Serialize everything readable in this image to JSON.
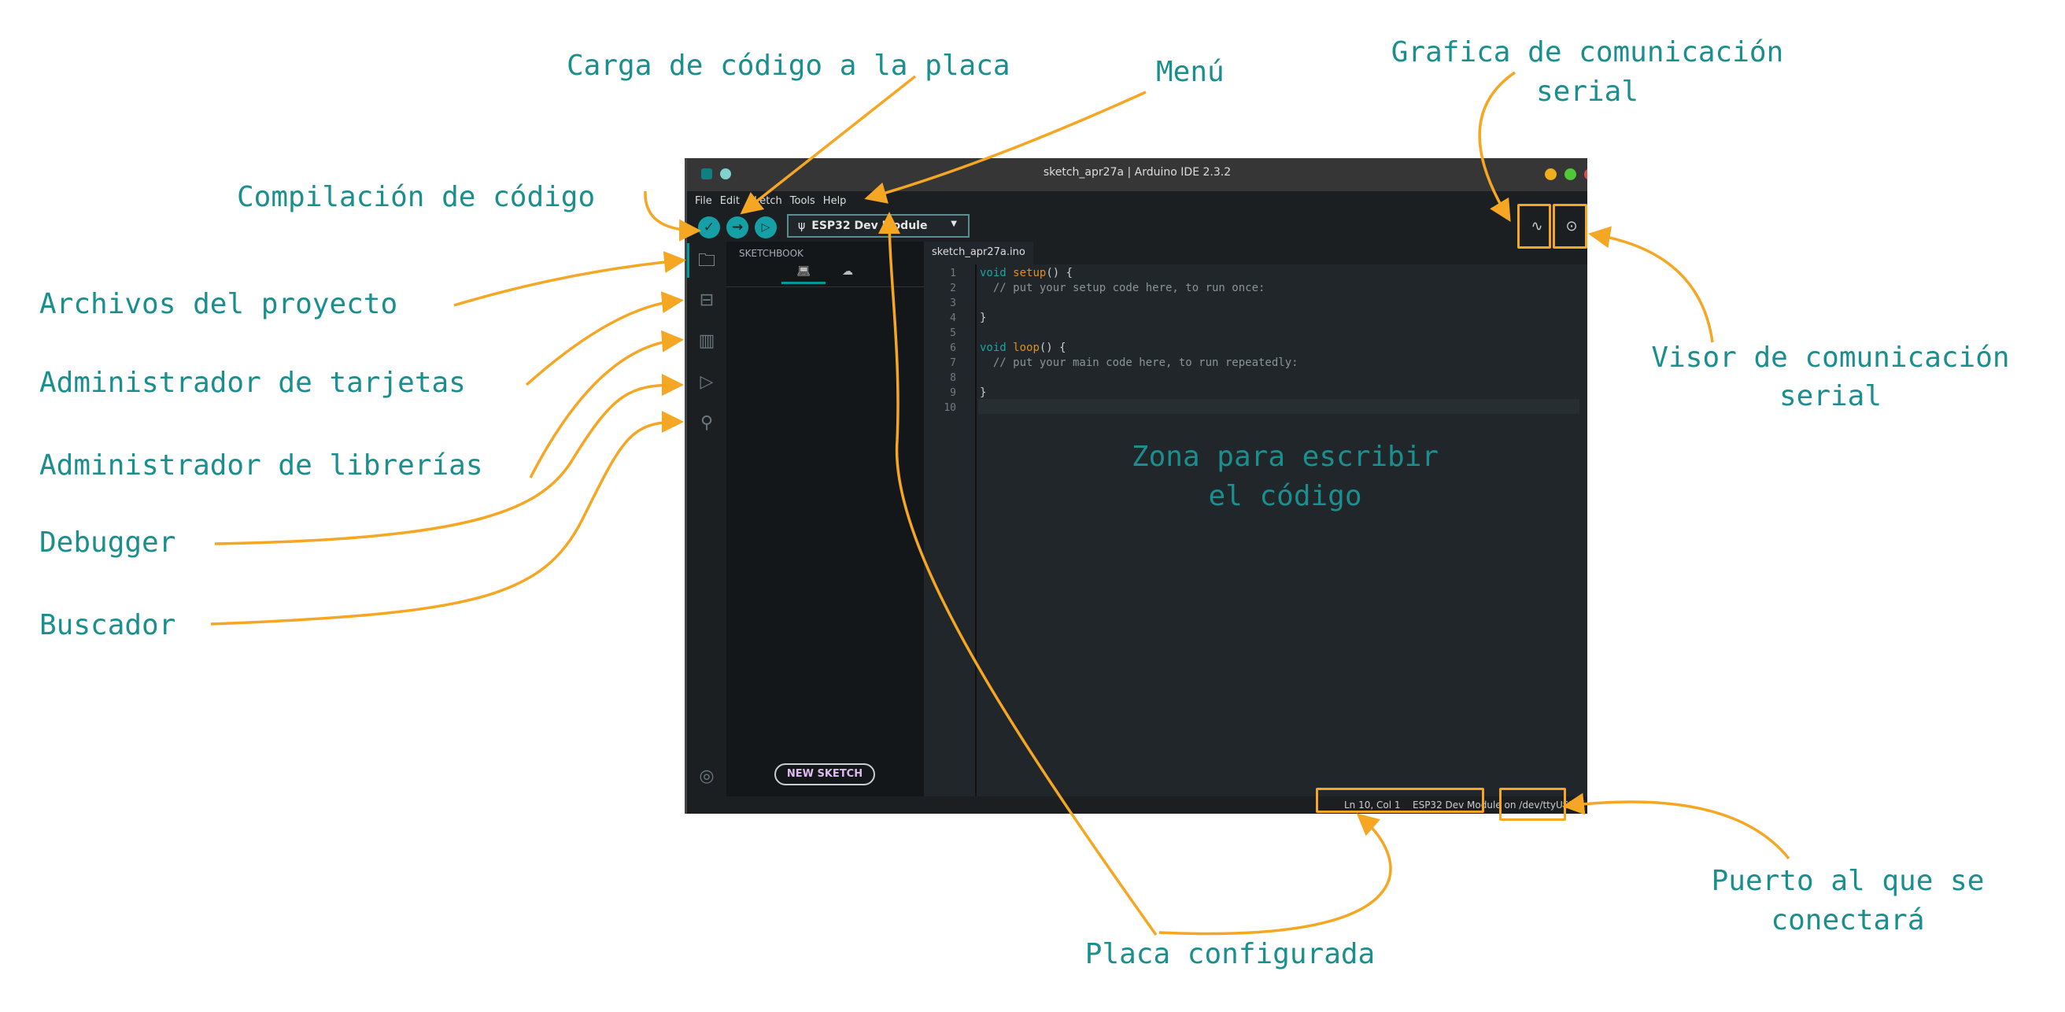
{
  "window": {
    "title": "sketch_apr27a | Arduino IDE 2.3.2",
    "controls": {
      "minimize": "#f0ad1e",
      "maximize": "#4fc93a",
      "close": "#e74c4c"
    }
  },
  "menu": [
    "File",
    "Edit",
    "Sketch",
    "Tools",
    "Help"
  ],
  "toolbar": {
    "verify_icon": "check-icon",
    "upload_icon": "arrow-right-icon",
    "debug_icon": "debug-icon",
    "board": "ESP32 Dev Module"
  },
  "sidebar": {
    "title": "SKETCHBOOK",
    "new_sketch": "NEW SKETCH"
  },
  "editor": {
    "tab": "sketch_apr27a.ino",
    "lines": [
      {
        "n": "1",
        "kw": "void ",
        "fn": "setup",
        "rest": "() {",
        "cm": ""
      },
      {
        "n": "2",
        "kw": "",
        "fn": "",
        "rest": "",
        "cm": "  // put your setup code here, to run once:"
      },
      {
        "n": "3",
        "kw": "",
        "fn": "",
        "rest": "",
        "cm": ""
      },
      {
        "n": "4",
        "kw": "",
        "fn": "",
        "rest": "}",
        "cm": ""
      },
      {
        "n": "5",
        "kw": "",
        "fn": "",
        "rest": "",
        "cm": ""
      },
      {
        "n": "6",
        "kw": "void ",
        "fn": "loop",
        "rest": "() {",
        "cm": ""
      },
      {
        "n": "7",
        "kw": "",
        "fn": "",
        "rest": "",
        "cm": "  // put your main code here, to run repeatedly:"
      },
      {
        "n": "8",
        "kw": "",
        "fn": "",
        "rest": "",
        "cm": ""
      },
      {
        "n": "9",
        "kw": "",
        "fn": "",
        "rest": "}",
        "cm": ""
      },
      {
        "n": "10",
        "kw": "",
        "fn": "",
        "rest": "",
        "cm": ""
      }
    ]
  },
  "status": {
    "position": "Ln 10, Col 1",
    "board_port": "ESP32 Dev Module on /dev/ttyUSB0"
  },
  "annotations": {
    "upload": "Carga de código a la placa",
    "menu": "Menú",
    "plotter_1": "Grafica de comunicación",
    "plotter_2": "serial",
    "compile": "Compilación de código",
    "files": "Archivos del proyecto",
    "boards": "Administrador de tarjetas",
    "libraries": "Administrador de librerías",
    "debugger": "Debugger",
    "search": "Buscador",
    "monitor_1": "Visor de comunicación",
    "monitor_2": "serial",
    "editor_1": "Zona para escribir",
    "editor_2": "el código",
    "port_1": "Puerto al que se",
    "port_2": "conectará",
    "board": "Placa configurada"
  },
  "colors": {
    "accent": "#00979d",
    "annotation": "#1b8e8e",
    "arrow": "#f5a623"
  }
}
